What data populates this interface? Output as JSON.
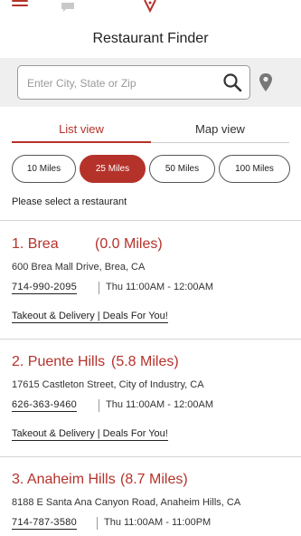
{
  "header": {
    "menu_icon": "hamburger-icon",
    "chat_icon": "chat-bubble-icon",
    "logo_icon": "brand-logo-icon",
    "title": "Restaurant Finder"
  },
  "search": {
    "placeholder": "Enter City, State or Zip",
    "value": "",
    "search_icon": "search-icon",
    "location_icon": "location-pin-icon"
  },
  "tabs": [
    {
      "label": "List view",
      "active": true
    },
    {
      "label": "Map view",
      "active": false
    }
  ],
  "radius_options": [
    {
      "label": "10 Miles",
      "active": false
    },
    {
      "label": "25 Miles",
      "active": true
    },
    {
      "label": "50 Miles",
      "active": false
    },
    {
      "label": "100 Miles",
      "active": false
    }
  ],
  "prompt": "Please select a restaurant",
  "restaurants": [
    {
      "name": "1. Brea",
      "distance": "(0.0 Miles)",
      "address": "600 Brea Mall Drive, Brea, CA",
      "phone": "714-990-2095",
      "hours": "Thu 11:00AM - 12:00AM",
      "links": "Takeout & Delivery | Deals For You!"
    },
    {
      "name": "2. Puente Hills",
      "distance": "(5.8 Miles)",
      "address": "17615 Castleton Street, City of Industry, CA",
      "phone": "626-363-9460",
      "hours": "Thu 11:00AM - 12:00AM",
      "links": "Takeout & Delivery | Deals For You!"
    },
    {
      "name": "3. Anaheim Hills",
      "distance": "(8.7 Miles)",
      "address": "8188 E Santa Ana Canyon Road, Anaheim Hills, CA",
      "phone": "714-787-3580",
      "hours": "Thu 11:00AM - 11:00PM",
      "links": ""
    }
  ],
  "colors": {
    "accent": "#b5322a",
    "search_band": "#efefef"
  }
}
